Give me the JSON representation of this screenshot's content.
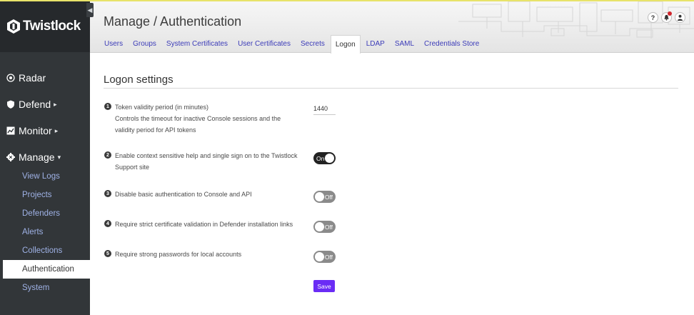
{
  "brand": {
    "name": "Twistlock"
  },
  "sidebar": {
    "main": [
      {
        "label": "Radar",
        "icon": "radar-icon",
        "caret": ""
      },
      {
        "label": "Defend",
        "icon": "shield-icon",
        "caret": "▸"
      },
      {
        "label": "Monitor",
        "icon": "monitor-icon",
        "caret": "▸"
      },
      {
        "label": "Manage",
        "icon": "gear-icon",
        "caret": "▾"
      }
    ],
    "sub": [
      "View Logs",
      "Projects",
      "Defenders",
      "Alerts",
      "Collections",
      "Authentication",
      "System"
    ],
    "active_sub": "Authentication"
  },
  "header": {
    "title": "Manage / Authentication",
    "tabs": [
      "Users",
      "Groups",
      "System Certificates",
      "User Certificates",
      "Secrets",
      "Logon",
      "LDAP",
      "SAML",
      "Credentials Store"
    ],
    "active_tab": "Logon",
    "icons": [
      "help-icon",
      "bell-icon",
      "user-icon"
    ]
  },
  "section": {
    "title": "Logon settings"
  },
  "settings": [
    {
      "num": "1",
      "label": "Token validity period (in minutes)",
      "description": "Controls the timeout for inactive Console sessions and the validity period for API tokens",
      "value": "1440"
    },
    {
      "num": "2",
      "label": "Enable context sensitive help and single sign on to the Twistlock Support site",
      "toggle": "On"
    },
    {
      "num": "3",
      "label": "Disable basic authentication to Console and API",
      "toggle": "Off"
    },
    {
      "num": "4",
      "label": "Require strict certificate validation in Defender installation links",
      "toggle": "Off"
    },
    {
      "num": "5",
      "label": "Require strong passwords for local accounts",
      "toggle": "Off"
    }
  ],
  "save_label": "Save",
  "colors": {
    "sidebar_bg": "#323639",
    "brand_bg": "#26292c",
    "link": "#9fb2e6",
    "accent": "#6a2cf5"
  }
}
